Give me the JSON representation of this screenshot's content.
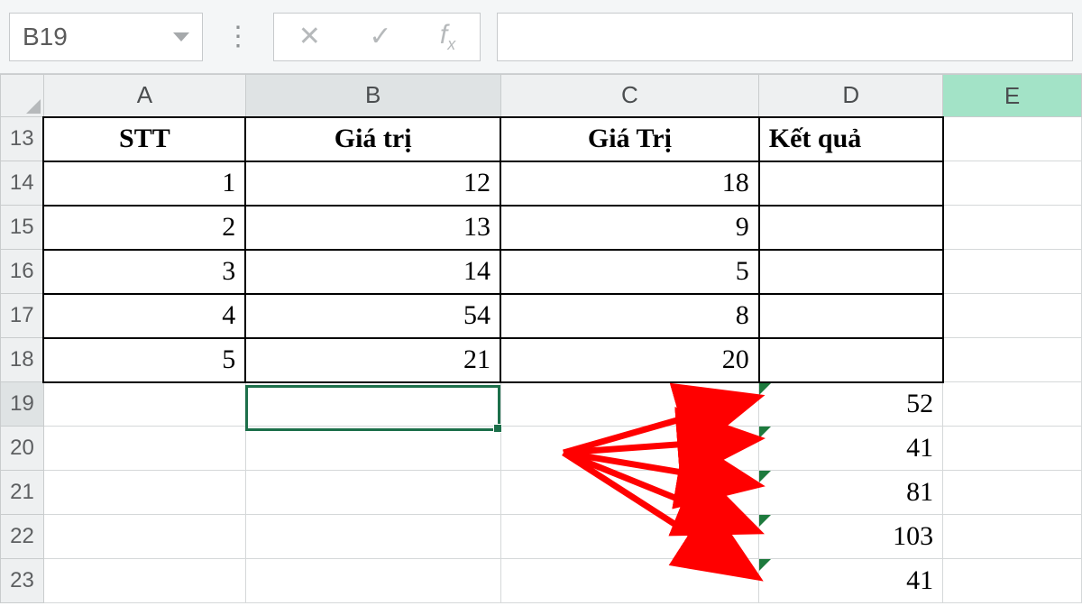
{
  "namebox": {
    "value": "B19"
  },
  "formula_bar": {
    "value": ""
  },
  "columns": [
    "A",
    "B",
    "C",
    "D",
    "E"
  ],
  "row_labels": [
    13,
    14,
    15,
    16,
    17,
    18,
    19,
    20,
    21,
    22,
    23
  ],
  "headers": {
    "A": "STT",
    "B": "Giá trị",
    "C": "Giá Trị",
    "D": "Kết quả"
  },
  "rows": [
    {
      "A": 1,
      "B": 12,
      "C": 18,
      "D": ""
    },
    {
      "A": 2,
      "B": 13,
      "C": 9,
      "D": ""
    },
    {
      "A": 3,
      "B": 14,
      "C": 5,
      "D": ""
    },
    {
      "A": 4,
      "B": 54,
      "C": 8,
      "D": ""
    },
    {
      "A": 5,
      "B": 21,
      "C": 20,
      "D": ""
    }
  ],
  "results": {
    "19": 52,
    "20": 41,
    "21": 81,
    "22": 103,
    "23": 41
  },
  "selection": {
    "cell": "B19"
  }
}
